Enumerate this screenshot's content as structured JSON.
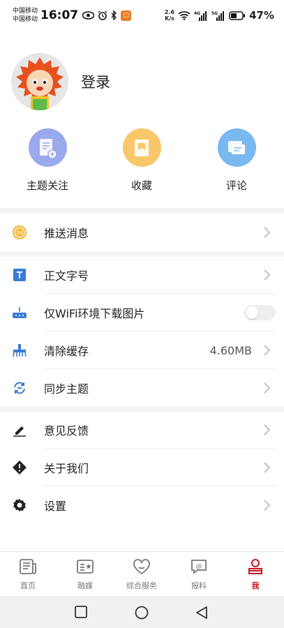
{
  "status_bar": {
    "carrier1": "中国移动",
    "carrier2": "中国移动",
    "time": "16:07",
    "app_badge": "🙂",
    "net_speed_value": "2.6",
    "net_speed_unit": "K/s",
    "signal1": "4G",
    "signal2": "5G",
    "battery": "47%"
  },
  "profile": {
    "login_label": "登录"
  },
  "actions": [
    {
      "label": "主题关注",
      "color": "#9aa8ec"
    },
    {
      "label": "收藏",
      "color": "#f9c76a"
    },
    {
      "label": "评论",
      "color": "#7ab8f0"
    }
  ],
  "menu": {
    "push": {
      "label": "推送消息"
    },
    "font_size": {
      "label": "正文字号"
    },
    "wifi_only": {
      "label": "仅WiFi环境下载图片",
      "enabled": false
    },
    "clear_cache": {
      "label": "清除缓存",
      "value": "4.60MB"
    },
    "sync_topics": {
      "label": "同步主题"
    },
    "feedback": {
      "label": "意见反馈"
    },
    "about": {
      "label": "关于我们"
    },
    "settings": {
      "label": "设置"
    }
  },
  "tabs": [
    {
      "label": "首页",
      "icon": "news-icon"
    },
    {
      "label": "融媒",
      "icon": "media-icon"
    },
    {
      "label": "综合服务",
      "icon": "services-icon"
    },
    {
      "label": "报料",
      "icon": "report-icon"
    },
    {
      "label": "我",
      "icon": "profile-icon",
      "active": true
    }
  ],
  "colors": {
    "accent": "#c8161d",
    "push_icon": "#f5b93a",
    "menu_icon_blue": "#3a7bd5"
  }
}
